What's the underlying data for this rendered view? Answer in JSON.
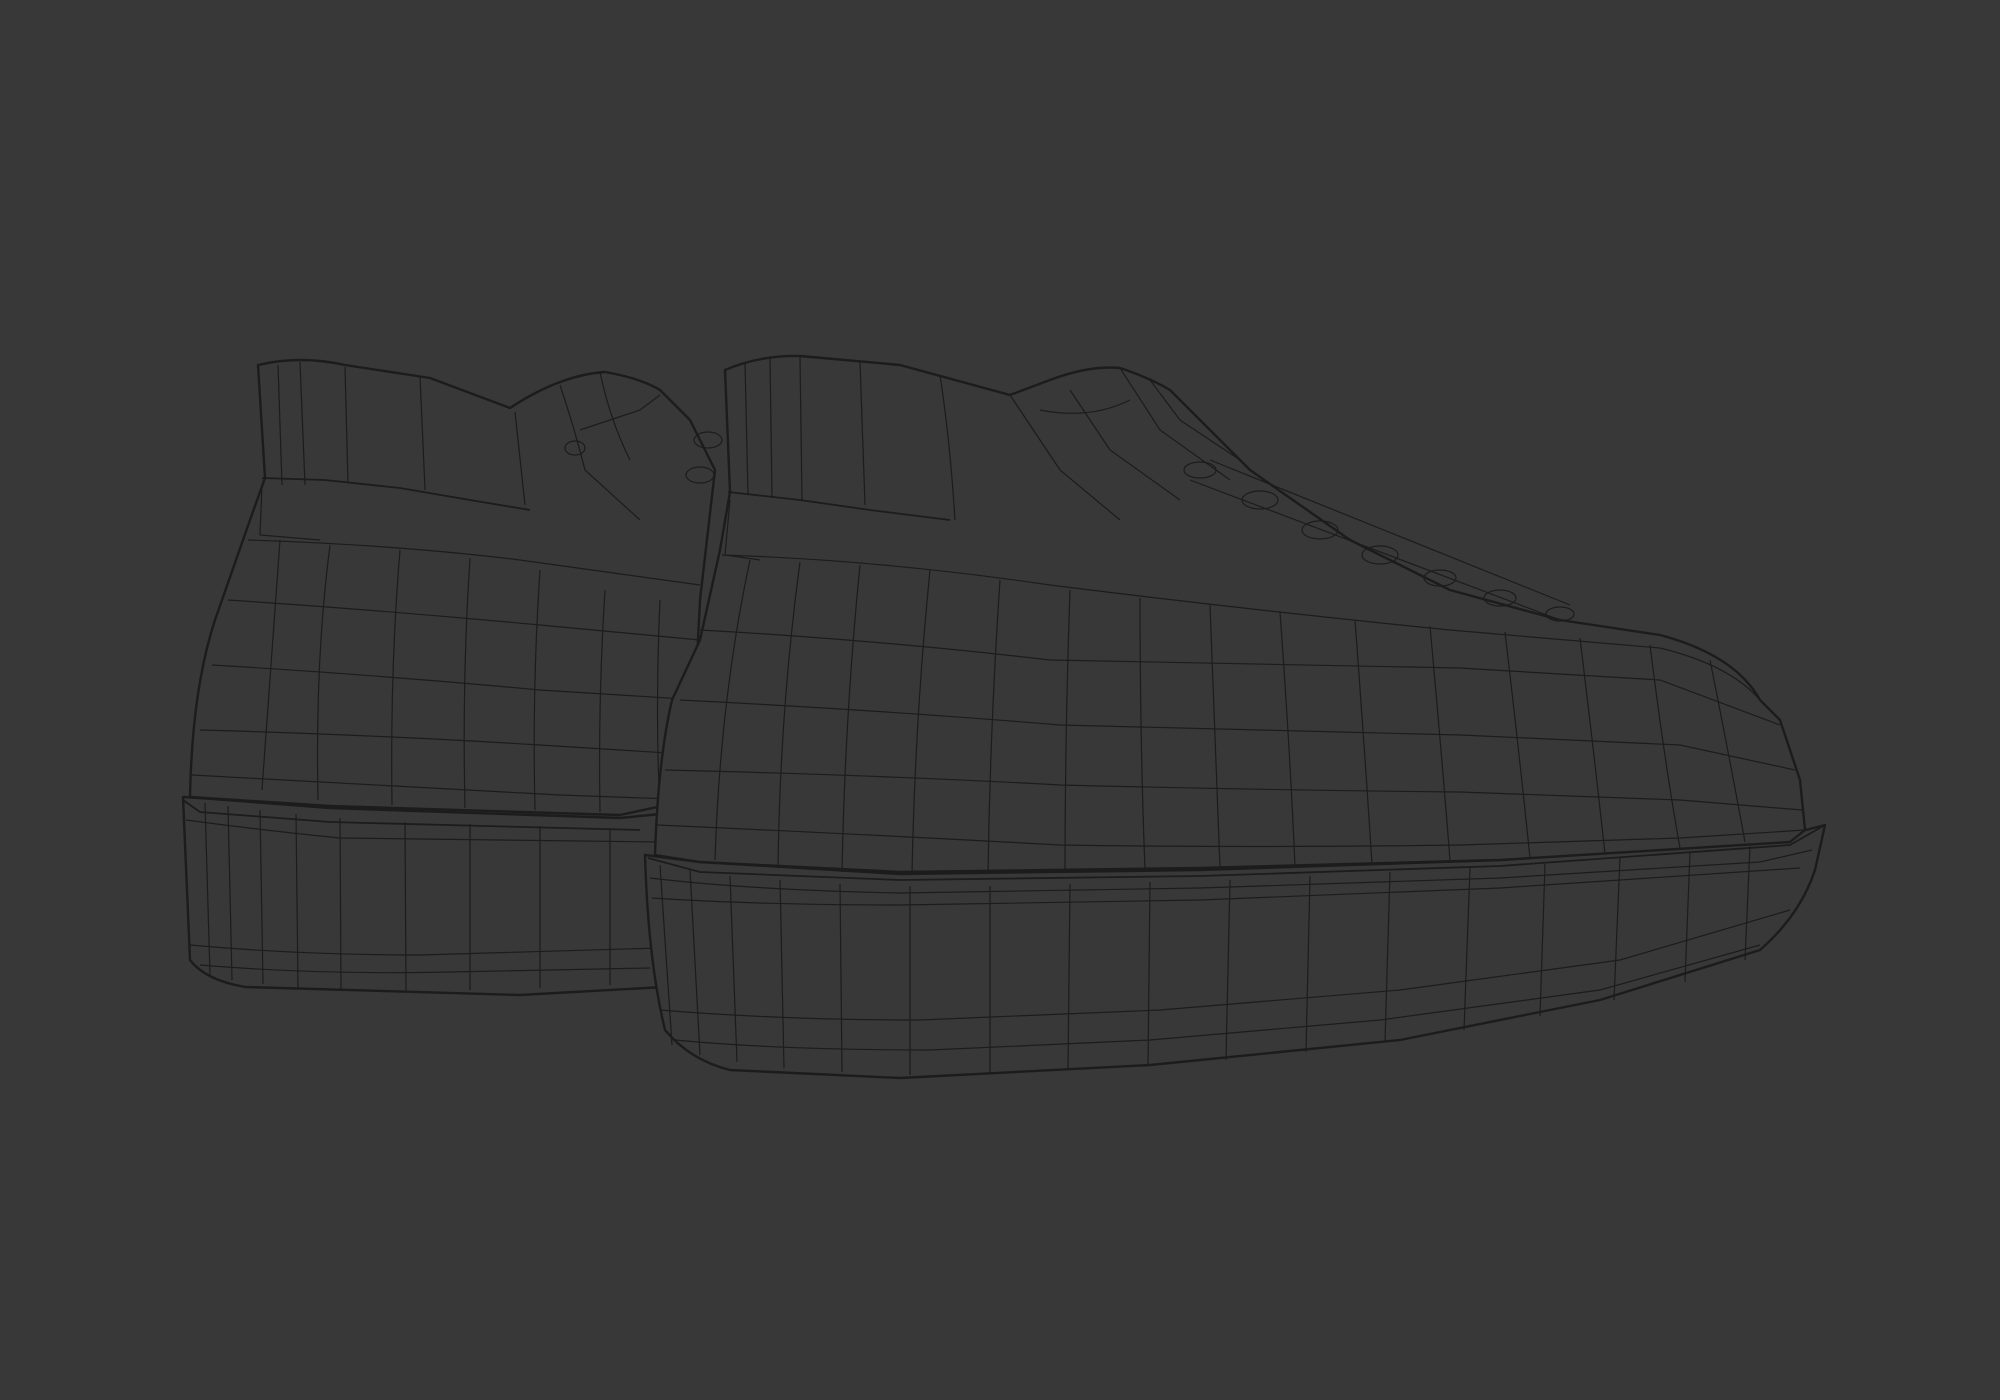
{
  "scene": {
    "background_color": "#383838",
    "wire_color": "#1c1c1c",
    "objects": [
      "left-shoe",
      "right-shoe"
    ]
  }
}
